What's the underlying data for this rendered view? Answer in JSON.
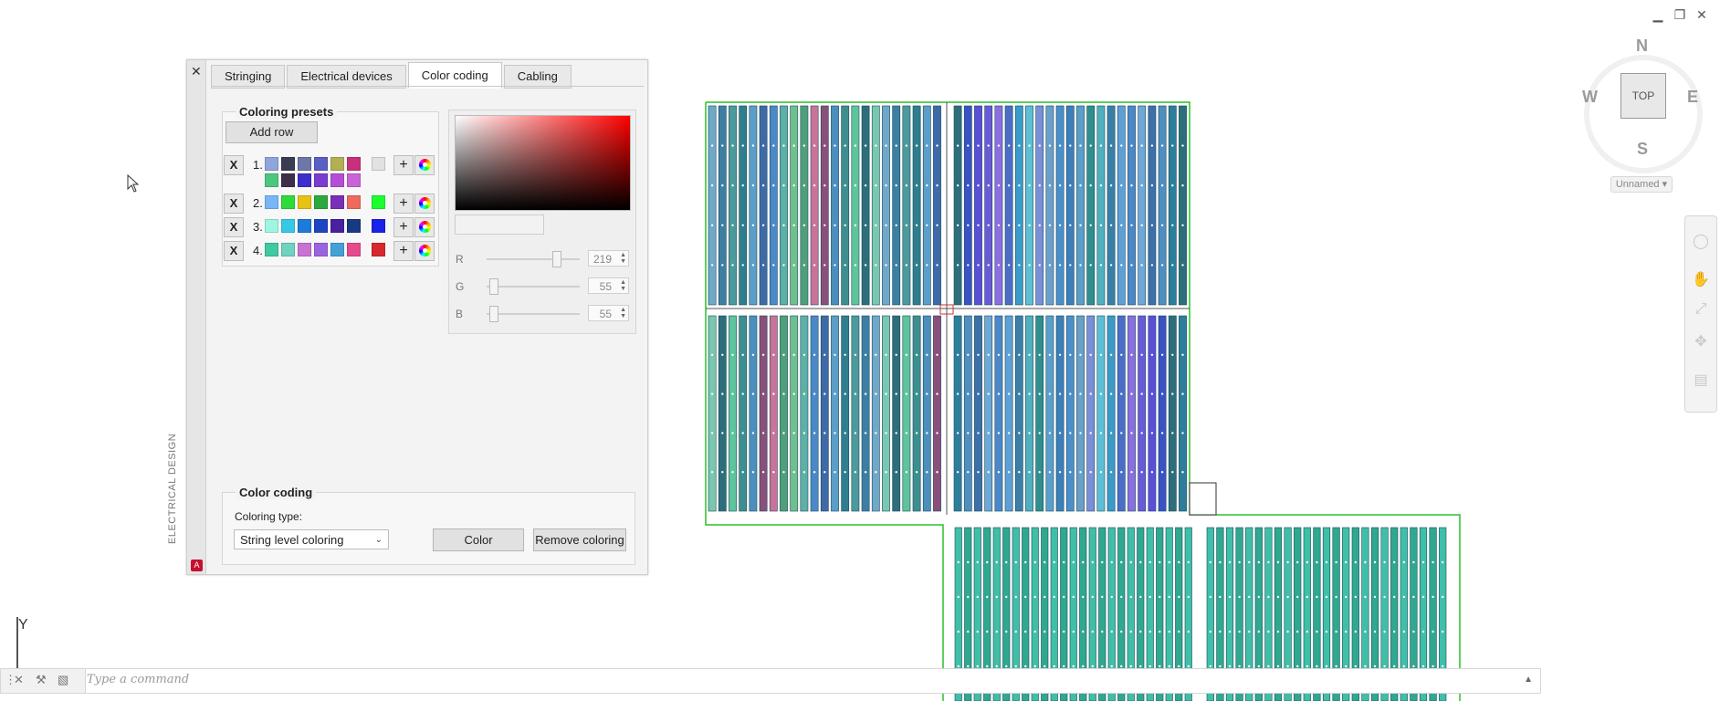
{
  "window_controls": [
    {
      "name": "minimize-button",
      "glyph": "▁"
    },
    {
      "name": "restore-button",
      "glyph": "❐"
    },
    {
      "name": "close-window-button",
      "glyph": "✕"
    }
  ],
  "palette": {
    "close_label": "✕",
    "side_title": "ELECTRICAL DESIGN",
    "logo": "A",
    "tabs": [
      "Stringing",
      "Electrical devices",
      "Color coding",
      "Cabling"
    ],
    "active_tab": "Color coding",
    "presets": {
      "title": "Coloring presets",
      "add_row_label": "Add row",
      "rows": [
        {
          "number": "1.",
          "delete": "X",
          "swatches": [
            "#8fa5dc",
            "#3a3d52",
            "#6d77a8",
            "#5a5fc4",
            "#b3b053",
            "#c9307b",
            "#4bc77e",
            "#3d2f4a",
            "#3b2ecc",
            "#7a3dd0",
            "#b34fd6",
            "#c964d8"
          ],
          "selected": "#e2e2e2"
        },
        {
          "number": "2.",
          "delete": "X",
          "swatches": [
            "#77b7f6",
            "#2ddc3a",
            "#e6c313",
            "#2aaa3c",
            "#7a2fb7",
            "#ee6b5b"
          ],
          "selected": "#1bff2f"
        },
        {
          "number": "3.",
          "delete": "X",
          "swatches": [
            "#9ef6e2",
            "#35c9e6",
            "#1d7bd9",
            "#1e44c2",
            "#4a1fa0",
            "#173a82"
          ],
          "selected": "#1a21e8"
        },
        {
          "number": "4.",
          "delete": "X",
          "swatches": [
            "#41c9a0",
            "#6fd3bf",
            "#c972d4",
            "#9a64e0",
            "#43a1d6",
            "#e64a8c"
          ],
          "selected": "#d7282e"
        }
      ]
    },
    "picker": {
      "base_color": "#ff0000",
      "r": {
        "label": "R",
        "value": "219",
        "fraction": 0.86
      },
      "g": {
        "label": "G",
        "value": "55",
        "fraction": 0.0
      },
      "b": {
        "label": "B",
        "value": "55",
        "fraction": 0.0
      }
    },
    "color_coding": {
      "title": "Color coding",
      "type_label": "Coloring type:",
      "type_value": "String level coloring",
      "color_button": "Color",
      "remove_button": "Remove coloring"
    }
  },
  "viewcube": {
    "north": "N",
    "south": "S",
    "east": "E",
    "west": "W",
    "top_label": "TOP",
    "ucs_label": "Unnamed ▾"
  },
  "command": {
    "placeholder": "Type a command",
    "arrow": "▲"
  },
  "ucs_axis": "Y",
  "drawing": {
    "border_color": "#2bbf2b",
    "upper_left_colors": [
      "#6fa8c9",
      "#3d7fa3",
      "#4c9a9c",
      "#2f7e8e",
      "#5b9ec7",
      "#3e6aa8",
      "#4b88c7",
      "#5cb0a8",
      "#6fbf8f",
      "#4fa07a",
      "#c9729a",
      "#8a4f7a",
      "#4c8fbf",
      "#3d8f8f",
      "#5ec49c",
      "#2d6e7a",
      "#7ac7b0"
    ],
    "upper_right_colors": [
      "#2d6e7a",
      "#3b52c4",
      "#5a4fd6",
      "#6a5ad8",
      "#8a6fe0",
      "#4a6ec7",
      "#3a9ac9",
      "#5cbfd6",
      "#7a8fd8",
      "#6a9fc9",
      "#4a8fc9",
      "#3d7fb8",
      "#5a9fc9",
      "#2f8e8e",
      "#4fb0bf",
      "#3a7fa8",
      "#5e9fd6",
      "#4c88c7",
      "#6fa8d6",
      "#3d6fa8",
      "#4f8fbf",
      "#2d7e9a"
    ],
    "bottom_color": "#3fbfa8"
  }
}
